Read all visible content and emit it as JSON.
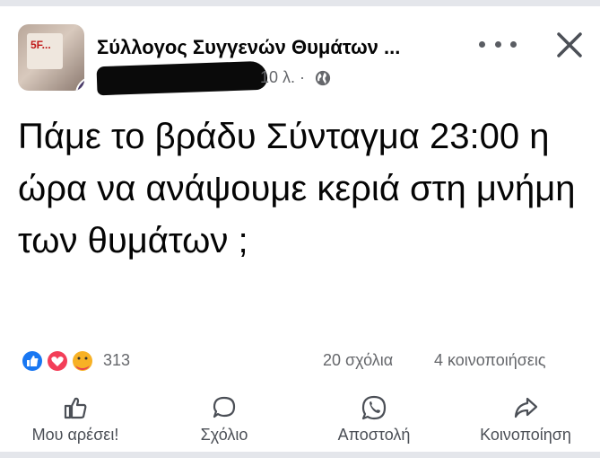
{
  "post": {
    "author": "Σύλλογος Συγγενών Θυμάτων ...",
    "time": "10 λ.",
    "separator": "·",
    "privacy_icon": "globe-icon",
    "avatar_sign_text": "5F...",
    "text": "Πάμε το βράδυ Σύνταγμα 23:00 η ώρα να ανάψουμε κεριά στη μνήμη των θυμάτων ;"
  },
  "header": {
    "more_icon": "more-icon",
    "close_icon": "close-icon"
  },
  "stats": {
    "reaction_icons": [
      "like-icon",
      "love-icon",
      "care-icon"
    ],
    "reaction_count": "313",
    "comments": "20 σχόλια",
    "shares": "4 κοινοποιήσεις"
  },
  "actions": {
    "like": "Μου αρέσει!",
    "comment": "Σχόλιο",
    "send": "Αποστολή",
    "share": "Κοινοποίηση"
  },
  "colors": {
    "like_blue": "#1877f2",
    "love_red": "#f33e58",
    "care_yellow": "#f7b125",
    "secondary_text": "#65676b"
  }
}
